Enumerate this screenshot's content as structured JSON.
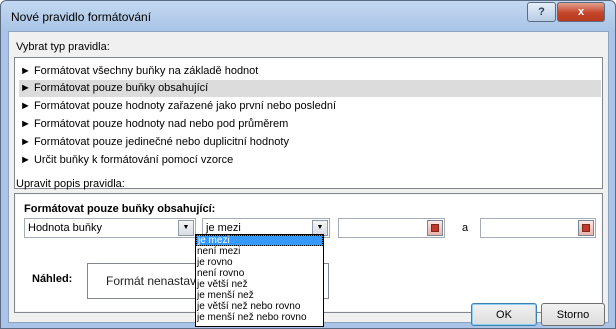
{
  "window": {
    "title": "Nové pravidlo formátování"
  },
  "titlebar": {
    "help_label": "?",
    "close_label": "x"
  },
  "rule_type": {
    "label": "Vybrat typ pravidla:",
    "items": [
      "► Formátovat všechny buňky na základě hodnot",
      "► Formátovat pouze buňky obsahující",
      "► Formátovat pouze hodnoty zařazené jako první nebo poslední",
      "► Formátovat pouze hodnoty nad nebo pod průměrem",
      "► Formátovat pouze jedinečné nebo duplicitní hodnoty",
      "► Určit buňky k formátování pomocí vzorce"
    ],
    "selected_index": 1
  },
  "description": {
    "label": "Upravit popis pravidla:",
    "heading": "Formátovat pouze buňky obsahující:",
    "field_combo": {
      "value": "Hodnota buňky"
    },
    "operator_combo": {
      "value": "je mezi"
    },
    "and_label": "a"
  },
  "operator_dropdown": {
    "options": [
      "je mezi",
      "není mezi",
      "je rovno",
      "není rovno",
      "je větší než",
      "je menší než",
      "je větší než nebo rovno",
      "je menší než nebo rovno"
    ],
    "selected_index": 0
  },
  "preview": {
    "label": "Náhled:",
    "text": "Formát nenastaven"
  },
  "buttons": {
    "ok": "OK",
    "cancel": "Storno"
  }
}
